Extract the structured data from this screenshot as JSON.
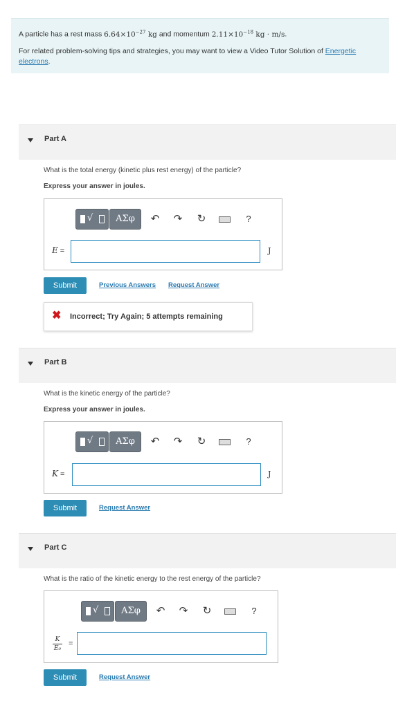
{
  "intro": {
    "line1_pre": "A particle has a rest mass ",
    "mass_base": "6.64×10",
    "mass_exp": "−27",
    "mass_unit": "kg",
    "line1_mid": " and momentum ",
    "mom_base": "2.11×10",
    "mom_exp": "−18",
    "mom_unit": "kg · m/s",
    "line1_end": ".",
    "line2": "For related problem-solving tips and strategies, you may want to view a Video Tutor Solution of",
    "link": "Energetic electrons",
    "line2_end": "."
  },
  "toolbar": {
    "greek_label": "ΑΣφ",
    "undo_icon": "undo-icon",
    "redo_icon": "redo-icon",
    "reset_icon": "reset-icon",
    "keyboard_icon": "keyboard-icon",
    "help_label": "?"
  },
  "partA": {
    "label": "Part A",
    "question": "What is the total energy (kinetic plus rest energy) of the particle?",
    "express": "Express your answer in joules.",
    "var": "E",
    "equals": "=",
    "unit": "J",
    "input_value": "",
    "submit": "Submit",
    "prev_answers": "Previous Answers",
    "request_answer": "Request Answer",
    "feedback": "Incorrect; Try Again; 5 attempts remaining",
    "feedback_icon": "✖"
  },
  "partB": {
    "label": "Part B",
    "question": "What is the kinetic energy of the particle?",
    "express": "Express your answer in joules.",
    "var": "K",
    "equals": "=",
    "unit": "J",
    "input_value": "",
    "submit": "Submit",
    "request_answer": "Request Answer"
  },
  "partC": {
    "label": "Part C",
    "question": "What is the ratio of the kinetic energy to the rest energy of the particle?",
    "var_num": "K",
    "var_den": "E₀",
    "equals": "=",
    "input_value": "",
    "submit": "Submit",
    "request_answer": "Request Answer"
  },
  "colors": {
    "accent": "#2d8db5",
    "intro_bg": "#e8f4f6",
    "error": "#d0171c"
  }
}
